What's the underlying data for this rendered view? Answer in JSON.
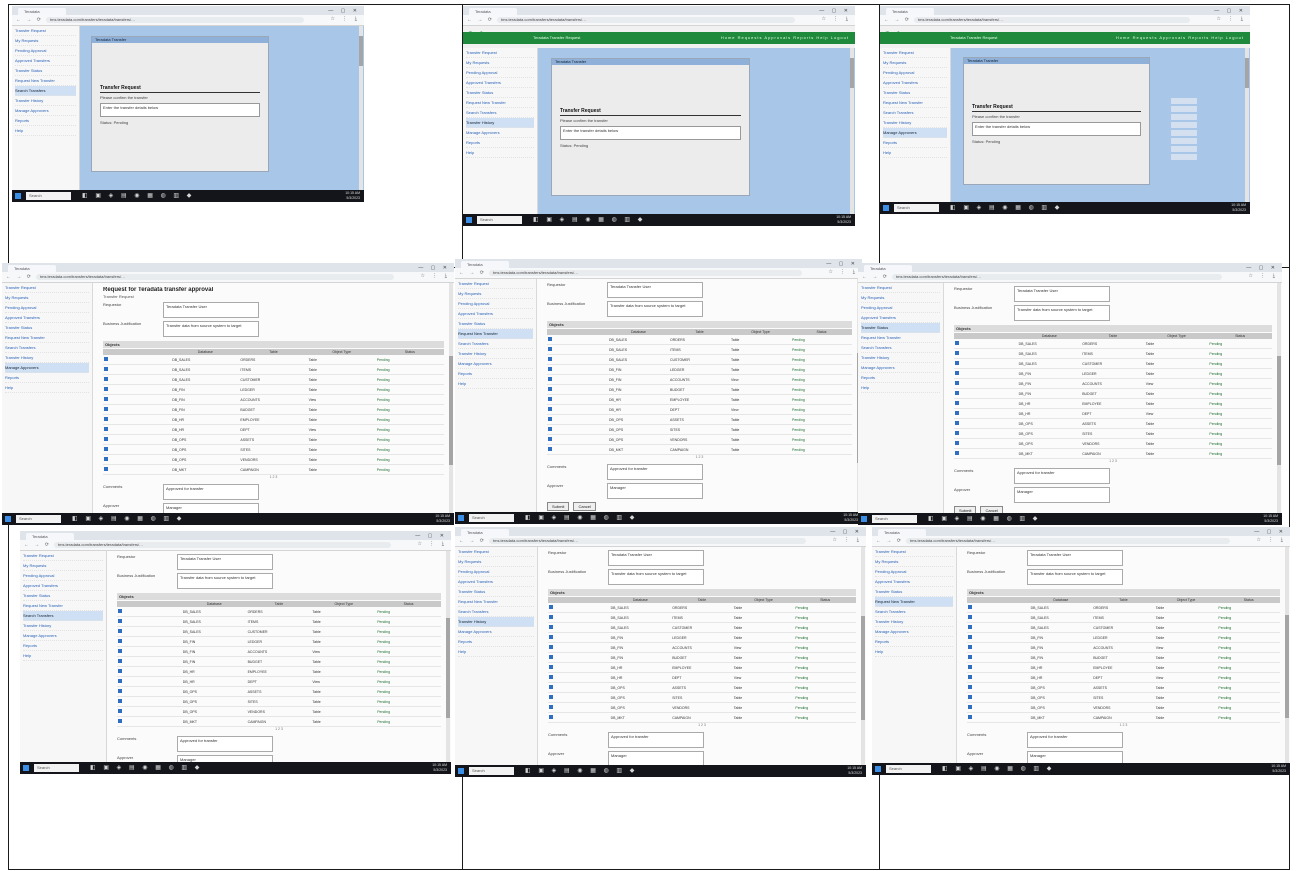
{
  "browser": {
    "tab_title": "Teradata",
    "url": "tms.teradata.com/transfers/teradata/transfers/…",
    "nav_glyphs": "← → ⟳ ⌂",
    "tools_glyphs": "☆ ⋮ ⤓",
    "window_controls": "— ▢ ✕"
  },
  "app": {
    "logo": "Sofa",
    "header_title": "Teradata Transfer Request",
    "header_menu": "Home  Requests  Approvals  Reports  Help  Logout"
  },
  "sidebar_items": [
    "Transfer Request",
    "My Requests",
    "Pending Approval",
    "Approved Transfers",
    "Transfer Status",
    "Request New Transfer",
    "Search Transfers",
    "Transfer History",
    "Manage Approvers",
    "Reports",
    "Help"
  ],
  "dialog": {
    "title_bar": "Teradata Transfer",
    "heading": "Transfer Request",
    "line1": "Please confirm the transfer",
    "box_text": "Enter the transfer details below",
    "line2": "Status: Pending"
  },
  "page": {
    "title": "Request for Teradata transfer approval",
    "subtitle": "Transfer Request",
    "field1_label": "Requestor",
    "field1_value": "Teradata Transfer User",
    "field2_label": "Business Justification",
    "field2_value": "Transfer data from source system to target",
    "section_label": "Objects",
    "columns": [
      "",
      "Database",
      "Table",
      "Object Type",
      "Status"
    ],
    "rows": [
      [
        "DB_SALES",
        "ORDERS",
        "Table",
        "Pending"
      ],
      [
        "DB_SALES",
        "ITEMS",
        "Table",
        "Pending"
      ],
      [
        "DB_SALES",
        "CUSTOMER",
        "Table",
        "Pending"
      ],
      [
        "DB_FIN",
        "LEDGER",
        "Table",
        "Pending"
      ],
      [
        "DB_FIN",
        "ACCOUNTS",
        "View",
        "Pending"
      ],
      [
        "DB_FIN",
        "BUDGET",
        "Table",
        "Pending"
      ],
      [
        "DB_HR",
        "EMPLOYEE",
        "Table",
        "Pending"
      ],
      [
        "DB_HR",
        "DEPT",
        "View",
        "Pending"
      ],
      [
        "DB_OPS",
        "ASSETS",
        "Table",
        "Pending"
      ],
      [
        "DB_OPS",
        "SITES",
        "Table",
        "Pending"
      ],
      [
        "DB_OPS",
        "VENDORS",
        "Table",
        "Pending"
      ],
      [
        "DB_MKT",
        "CAMPAIGN",
        "Table",
        "Pending"
      ]
    ],
    "pager": "1 2 3",
    "comments_label": "Comments",
    "comments_value": "Approved for transfer",
    "approver_label": "Approver",
    "approver_value": "Manager",
    "btn_submit": "Submit",
    "btn_cancel": "Cancel",
    "success_msg": "Your request has been submitted successfully for approval."
  },
  "taskbar": {
    "search_placeholder": "Search",
    "apps_glyphs": "◧ ▣ ◈ ▤ ◉ ▦ ◍ ▥ ◆",
    "time": "10:15 AM",
    "date": "5/3/2023"
  }
}
